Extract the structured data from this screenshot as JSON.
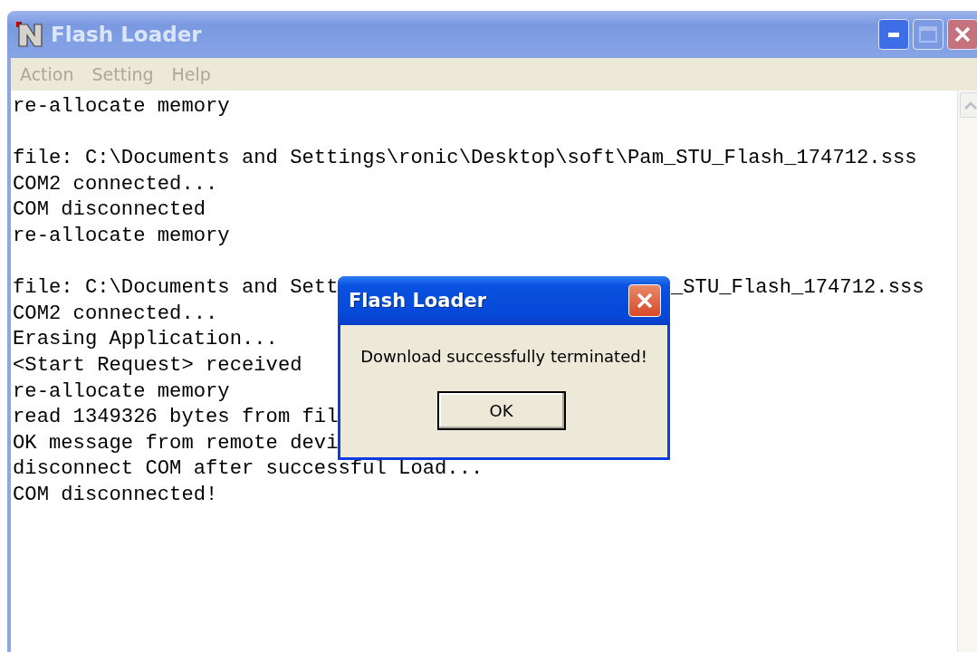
{
  "window": {
    "title": "Flash Loader",
    "active": false
  },
  "menu": [
    {
      "label": "Action"
    },
    {
      "label": "Setting"
    },
    {
      "label": "Help"
    }
  ],
  "log": [
    {
      "kind": "line",
      "text": "re-allocate memory"
    },
    {
      "kind": "blank"
    },
    {
      "kind": "line",
      "text": "file: C:\\Documents and Settings\\ronic\\Desktop\\soft\\Pam_STU_Flash_174712.sss"
    },
    {
      "kind": "line",
      "text": "COM2 connected..."
    },
    {
      "kind": "line",
      "text": "COM disconnected"
    },
    {
      "kind": "line",
      "text": "re-allocate memory"
    },
    {
      "kind": "blank"
    },
    {
      "kind": "line",
      "text": "file: C:\\Documents and Sett",
      "tail": "_STU_Flash_174712.sss"
    },
    {
      "kind": "line",
      "text": "COM2 connected..."
    },
    {
      "kind": "line",
      "text": "Erasing Application..."
    },
    {
      "kind": "line",
      "text": "<Start Request> received"
    },
    {
      "kind": "line",
      "text": "re-allocate memory"
    },
    {
      "kind": "line",
      "text": "read 1349326 bytes from fil"
    },
    {
      "kind": "line",
      "text": "OK message from remote devi"
    },
    {
      "kind": "line",
      "text": "disconnect COM after successful Load..."
    },
    {
      "kind": "line",
      "text": "COM disconnected!"
    }
  ],
  "dialog": {
    "title": "Flash Loader",
    "message": "Download successfully terminated!",
    "button": "OK"
  }
}
